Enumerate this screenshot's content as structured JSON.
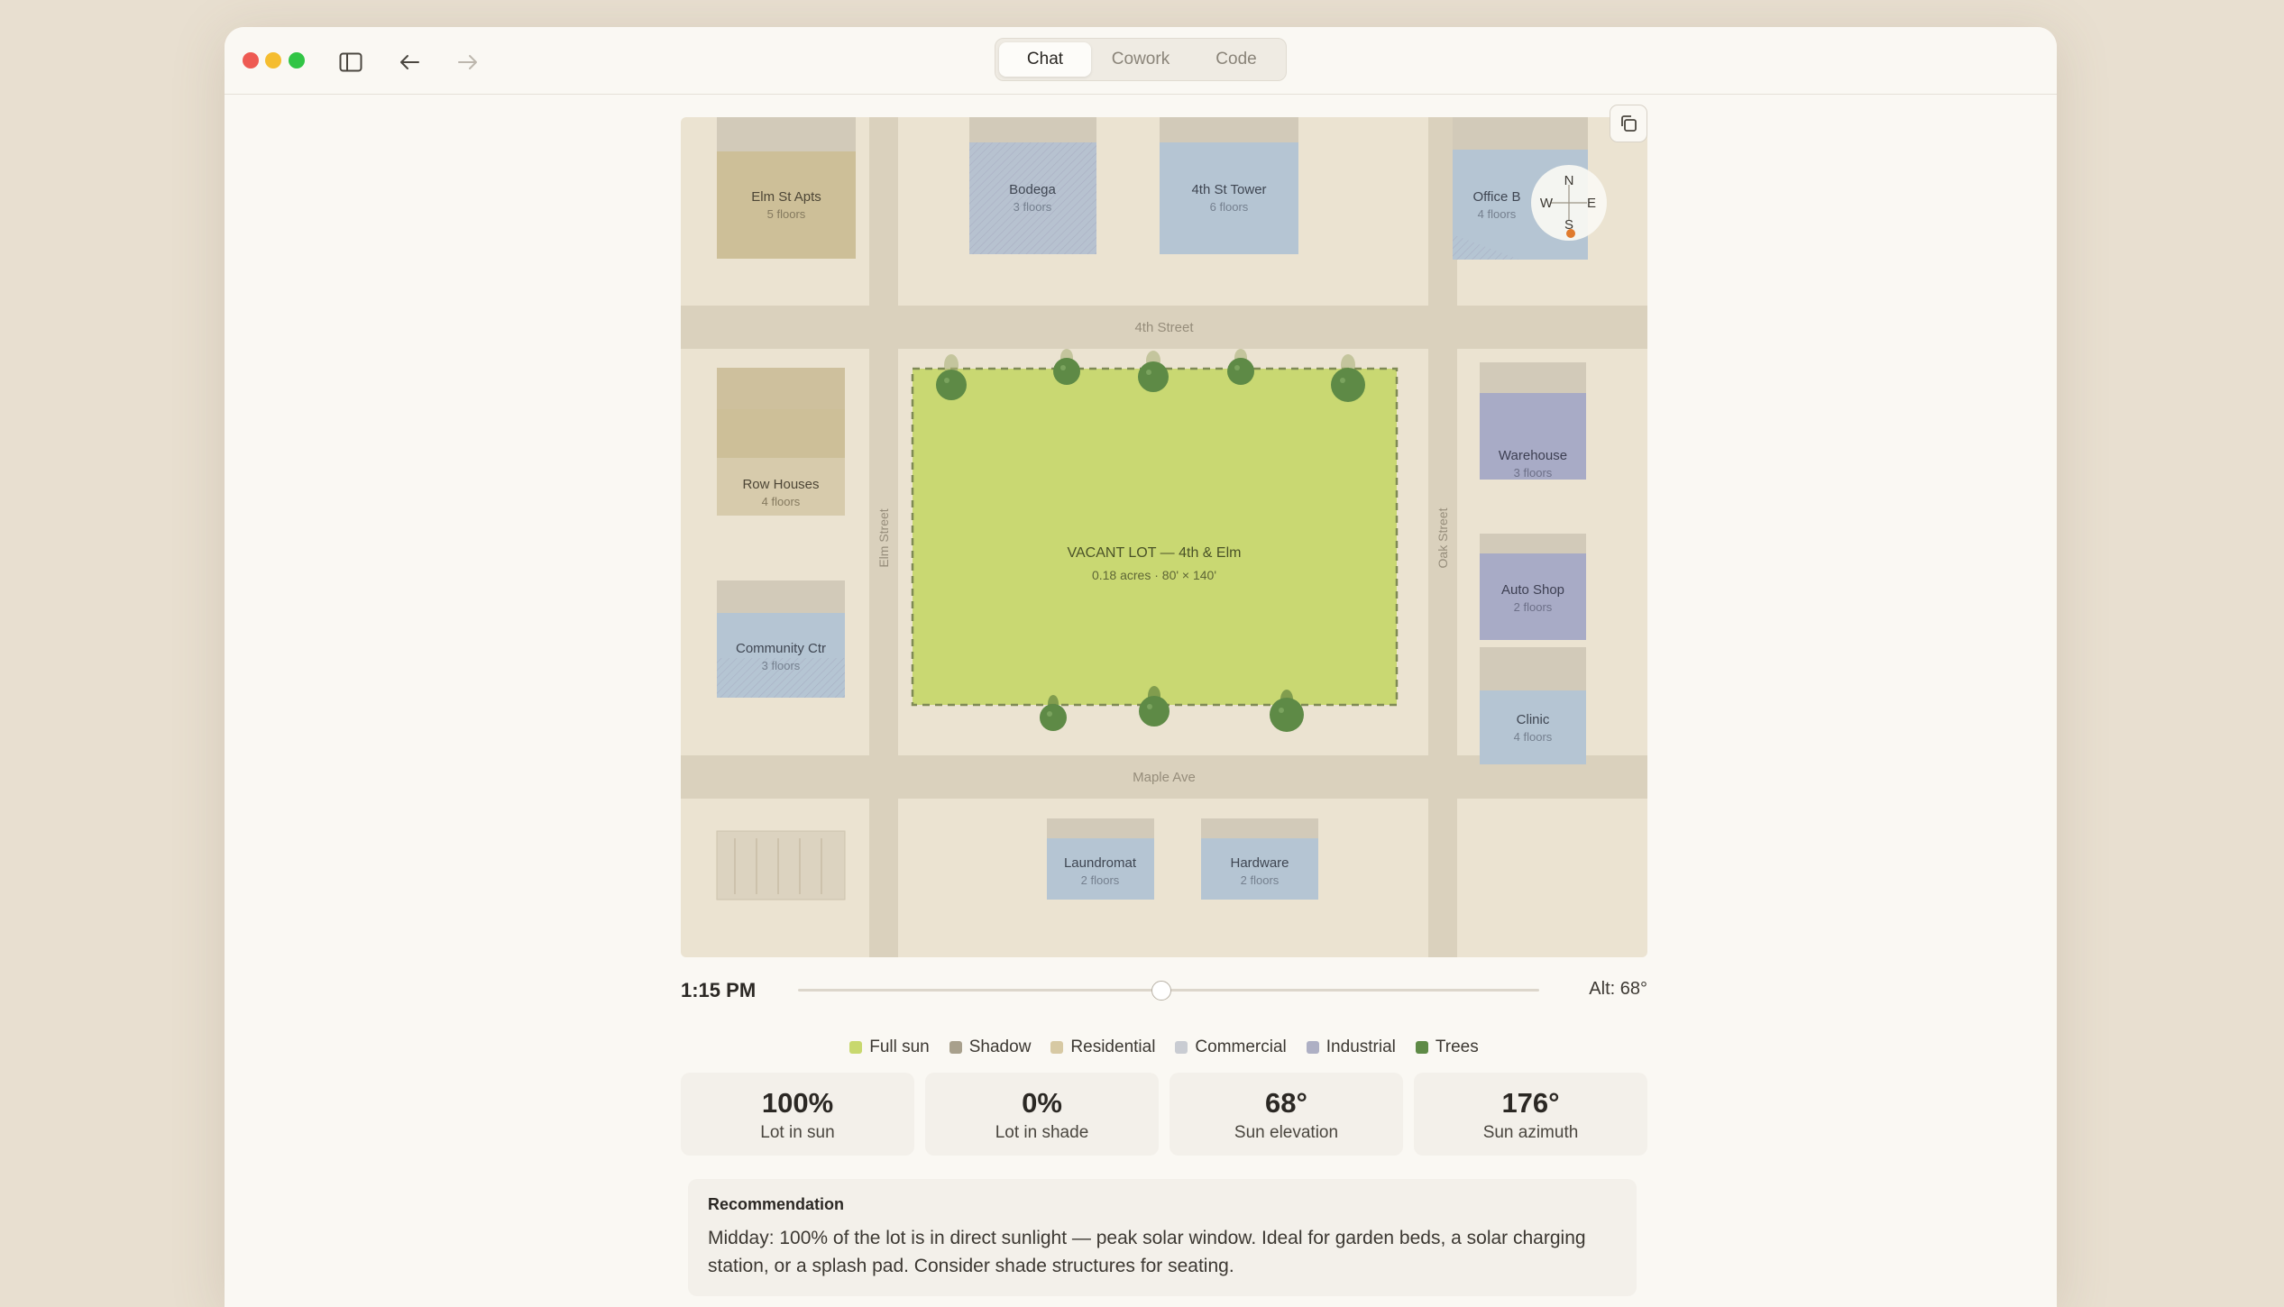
{
  "tabs": [
    {
      "label": "Chat",
      "active": true
    },
    {
      "label": "Cowork",
      "active": false
    },
    {
      "label": "Code",
      "active": false
    }
  ],
  "compass": {
    "n": "N",
    "s": "S",
    "e": "E",
    "w": "W"
  },
  "map": {
    "streets": {
      "top": "4th Street",
      "bottom": "Maple Ave",
      "left": "Elm Street",
      "right": "Oak Street"
    },
    "buildings": {
      "elm_st_apts": {
        "name": "Elm St Apts",
        "floors": "5 floors"
      },
      "bodega": {
        "name": "Bodega",
        "floors": "3 floors"
      },
      "fourth_st_tower": {
        "name": "4th St Tower",
        "floors": "6 floors"
      },
      "office": {
        "name": "Office B",
        "floors": "4 floors"
      },
      "row_houses": {
        "name": "Row Houses",
        "floors": "4 floors"
      },
      "community_ctr": {
        "name": "Community Ctr",
        "floors": "3 floors"
      },
      "warehouse": {
        "name": "Warehouse",
        "floors": "3 floors"
      },
      "auto_shop": {
        "name": "Auto Shop",
        "floors": "2 floors"
      },
      "clinic": {
        "name": "Clinic",
        "floors": "4 floors"
      },
      "laundromat": {
        "name": "Laundromat",
        "floors": "2 floors"
      },
      "hardware": {
        "name": "Hardware",
        "floors": "2 floors"
      }
    },
    "lot": {
      "title": "VACANT LOT — 4th & Elm",
      "details": "0.18 acres · 80' × 140'"
    }
  },
  "slider": {
    "time": "1:15 PM",
    "altitude": "Alt: 68°",
    "position": 0.49
  },
  "legend": [
    {
      "label": "Full sun",
      "color": "#c8d86e"
    },
    {
      "label": "Shadow",
      "color": "#a8a08c"
    },
    {
      "label": "Residential",
      "color": "#d7c9a3"
    },
    {
      "label": "Commercial",
      "color": "#c9ccd2"
    },
    {
      "label": "Industrial",
      "color": "#aeb0c4"
    },
    {
      "label": "Trees",
      "color": "#5e8a46"
    }
  ],
  "stats": [
    {
      "value": "100%",
      "label": "Lot in sun"
    },
    {
      "value": "0%",
      "label": "Lot in shade"
    },
    {
      "value": "68°",
      "label": "Sun elevation"
    },
    {
      "value": "176°",
      "label": "Sun azimuth"
    }
  ],
  "recommendation": {
    "title": "Recommendation",
    "text": "Midday: 100% of the lot is in direct sunlight — peak solar window. Ideal for garden beds, a solar charging station, or a splash pad. Consider shade structures for seating."
  },
  "colors": {
    "ground": "#ebe3d1",
    "street": "#dad1bd",
    "residential": "#cdbf98",
    "commercial": "#b5c5d3",
    "industrial": "#a8abc6",
    "lot": "#c9d872",
    "tree": "#5e8a46"
  }
}
